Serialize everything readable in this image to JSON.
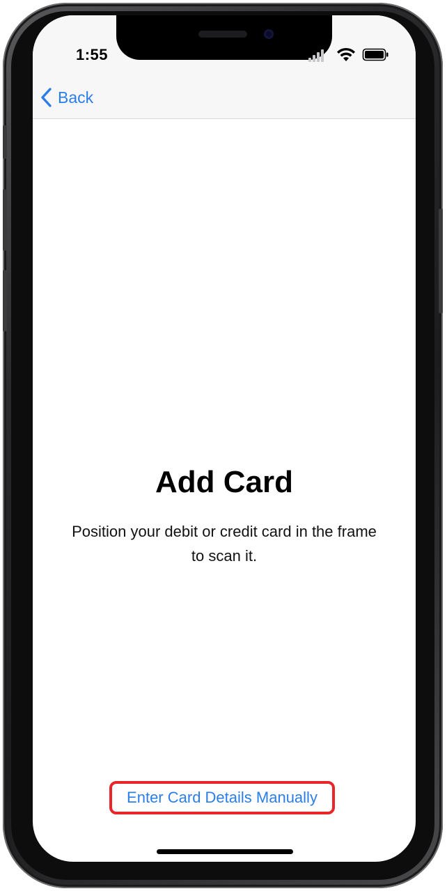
{
  "status_bar": {
    "time": "1:55"
  },
  "nav": {
    "back_label": "Back"
  },
  "main": {
    "title": "Add Card",
    "description": "Position your debit or credit card in the frame to scan it.",
    "manual_button_label": "Enter Card Details Manually"
  },
  "colors": {
    "accent": "#2b7de9",
    "highlight_border": "#e8262a"
  }
}
